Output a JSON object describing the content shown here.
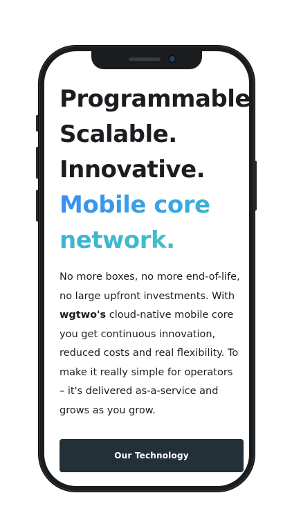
{
  "hero": {
    "headline_lines": [
      "Programmable.",
      "Scalable.",
      "Innovative."
    ],
    "highlight_line_1": "Mobile core",
    "highlight_line_2": "network.",
    "body_part1": "No more boxes, no more end-of-life, no large upfront investments. With ",
    "brand": "wgtwo's",
    "body_part2": " cloud-native mobile core you get continuous innovation, reduced costs and real flexibility. To make it really simple for operators – it's delivered as-a-service and grows as you grow.",
    "cta_label": "Our Technology"
  },
  "colors": {
    "headline": "#1b1d20",
    "gradient_blue": "#3a8ff0",
    "gradient_teal": "#48c2c0",
    "cta_background": "#243038",
    "phone_frame": "#1b1c1e"
  }
}
